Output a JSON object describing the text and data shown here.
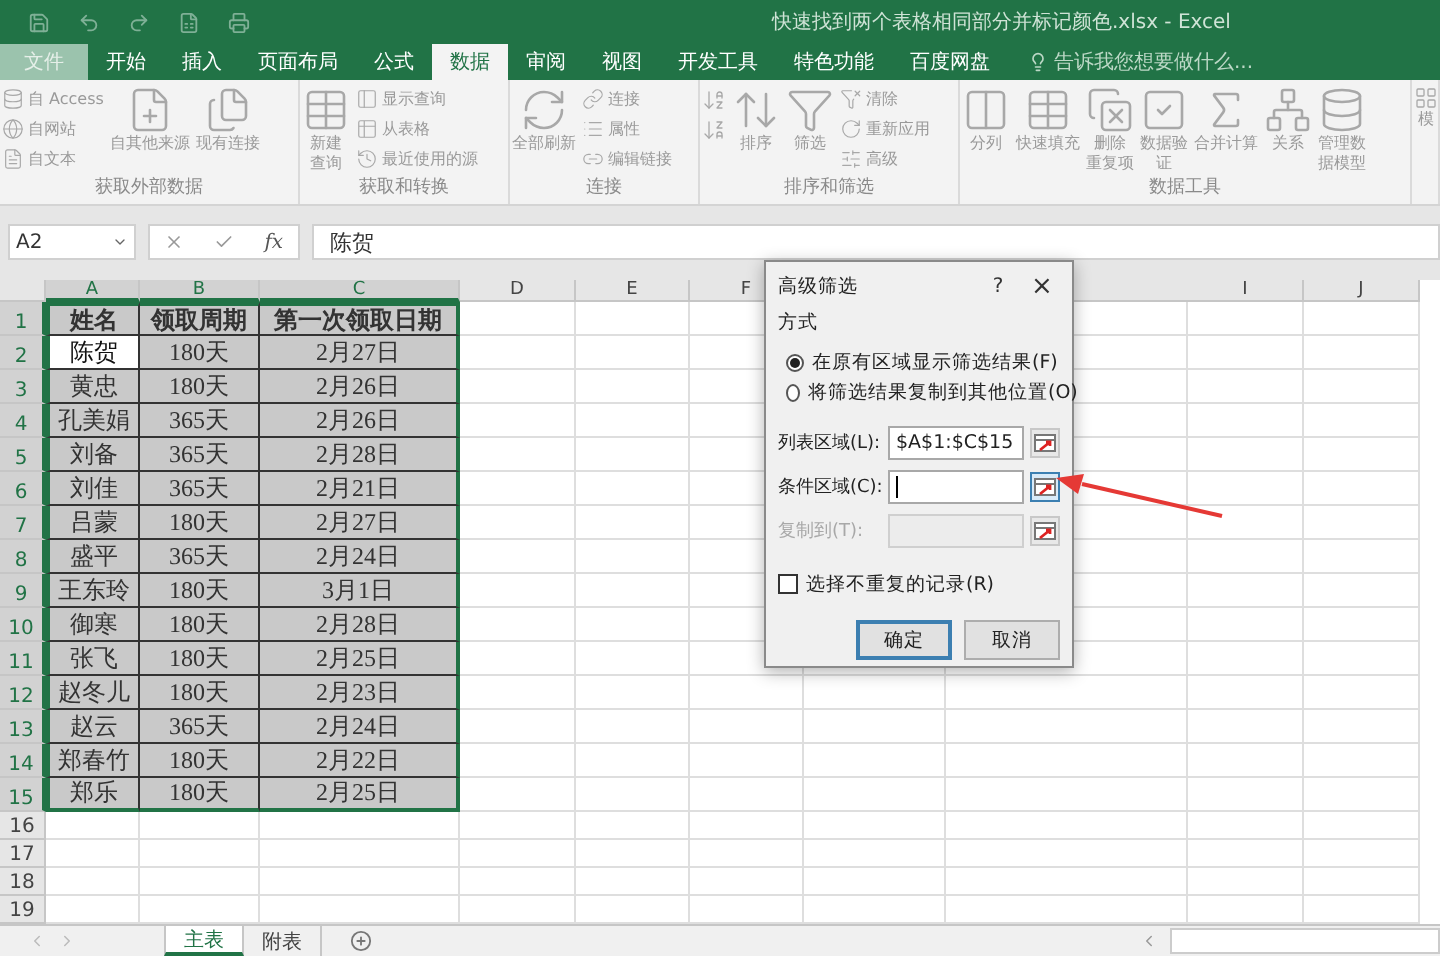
{
  "window": {
    "title": "快速找到两个表格相同部分并标记颜色.xlsx - Excel"
  },
  "tabs": [
    {
      "label": "文件",
      "kind": "file",
      "selected": false
    },
    {
      "label": "开始",
      "kind": "tab",
      "selected": false
    },
    {
      "label": "插入",
      "kind": "tab",
      "selected": false
    },
    {
      "label": "页面布局",
      "kind": "tab",
      "selected": false
    },
    {
      "label": "公式",
      "kind": "tab",
      "selected": false
    },
    {
      "label": "数据",
      "kind": "tab",
      "selected": true
    },
    {
      "label": "审阅",
      "kind": "tab",
      "selected": false
    },
    {
      "label": "视图",
      "kind": "tab",
      "selected": false
    },
    {
      "label": "开发工具",
      "kind": "tab",
      "selected": false
    },
    {
      "label": "特色功能",
      "kind": "tab",
      "selected": false
    },
    {
      "label": "百度网盘",
      "kind": "tab",
      "selected": false
    }
  ],
  "tell_me": {
    "placeholder": "告诉我您想要做什么..."
  },
  "ribbon": {
    "groups": [
      {
        "label": "获取外部数据",
        "items": [
          {
            "kind": "small",
            "lines": [
              "自 Access"
            ]
          },
          {
            "kind": "small",
            "lines": [
              "自网站"
            ]
          },
          {
            "kind": "small",
            "lines": [
              "自文本"
            ]
          },
          {
            "kind": "large",
            "lines": [
              "自其他来源"
            ]
          },
          {
            "kind": "large",
            "lines": [
              "现有连接"
            ]
          }
        ]
      },
      {
        "label": "获取和转换",
        "items": [
          {
            "kind": "large",
            "lines": [
              "新建",
              "查询"
            ]
          },
          {
            "kind": "small",
            "lines": [
              "显示查询"
            ]
          },
          {
            "kind": "small",
            "lines": [
              "从表格"
            ]
          },
          {
            "kind": "small",
            "lines": [
              "最近使用的源"
            ]
          }
        ]
      },
      {
        "label": "连接",
        "items": [
          {
            "kind": "large",
            "lines": [
              "全部刷新"
            ]
          },
          {
            "kind": "small",
            "lines": [
              "连接"
            ]
          },
          {
            "kind": "small",
            "lines": [
              "属性"
            ]
          },
          {
            "kind": "small",
            "lines": [
              "编辑链接"
            ]
          }
        ]
      },
      {
        "label": "排序和筛选",
        "items": [
          {
            "kind": "icon"
          },
          {
            "kind": "icon"
          },
          {
            "kind": "large",
            "lines": [
              "排序"
            ]
          },
          {
            "kind": "large",
            "lines": [
              "筛选"
            ]
          },
          {
            "kind": "small",
            "lines": [
              "清除"
            ]
          },
          {
            "kind": "small",
            "lines": [
              "重新应用"
            ]
          },
          {
            "kind": "small",
            "lines": [
              "高级"
            ]
          }
        ]
      },
      {
        "label": "数据工具",
        "items": [
          {
            "kind": "large",
            "lines": [
              "分列"
            ]
          },
          {
            "kind": "large",
            "lines": [
              "快速填充"
            ]
          },
          {
            "kind": "large",
            "lines": [
              "删除",
              "重复项"
            ]
          },
          {
            "kind": "large",
            "lines": [
              "数据验",
              "证"
            ]
          },
          {
            "kind": "large",
            "lines": [
              "合并计算"
            ]
          },
          {
            "kind": "large",
            "lines": [
              "关系"
            ]
          },
          {
            "kind": "large",
            "lines": [
              "管理数",
              "据模型"
            ]
          }
        ]
      },
      {
        "items": [
          {
            "kind": "large",
            "lines": [
              "模"
            ]
          }
        ]
      }
    ]
  },
  "formula_bar": {
    "name_box": "A2",
    "function_button": "fx",
    "value": "陈贺"
  },
  "sheet": {
    "columns_left": [
      {
        "label": "A",
        "selected": true
      },
      {
        "label": "B",
        "selected": true
      },
      {
        "label": "C",
        "selected": true
      },
      {
        "label": "D",
        "selected": false
      },
      {
        "label": "E",
        "selected": false
      },
      {
        "label": "F",
        "selected": false
      }
    ],
    "columns_right": [
      {
        "label": "I",
        "selected": false
      },
      {
        "label": "J",
        "selected": false
      }
    ],
    "rows": [
      {
        "header": "1",
        "kind": "header",
        "selected": true,
        "cells": [
          {
            "text": "姓名",
            "active": false
          },
          {
            "text": "领取周期",
            "active": false
          },
          {
            "text": "第一次领取日期",
            "active": false
          }
        ]
      },
      {
        "header": "2",
        "kind": "data",
        "selected": true,
        "cells": [
          {
            "text": "陈贺",
            "active": true
          },
          {
            "text": "180天",
            "active": false
          },
          {
            "text": "2月27日",
            "active": false
          }
        ]
      },
      {
        "header": "3",
        "kind": "data",
        "selected": true,
        "cells": [
          {
            "text": "黄忠",
            "active": false
          },
          {
            "text": "180天",
            "active": false
          },
          {
            "text": "2月26日",
            "active": false
          }
        ]
      },
      {
        "header": "4",
        "kind": "data",
        "selected": true,
        "cells": [
          {
            "text": "孔美娟",
            "active": false
          },
          {
            "text": "365天",
            "active": false
          },
          {
            "text": "2月26日",
            "active": false
          }
        ]
      },
      {
        "header": "5",
        "kind": "data",
        "selected": true,
        "cells": [
          {
            "text": "刘备",
            "active": false
          },
          {
            "text": "365天",
            "active": false
          },
          {
            "text": "2月28日",
            "active": false
          }
        ]
      },
      {
        "header": "6",
        "kind": "data",
        "selected": true,
        "cells": [
          {
            "text": "刘佳",
            "active": false
          },
          {
            "text": "365天",
            "active": false
          },
          {
            "text": "2月21日",
            "active": false
          }
        ]
      },
      {
        "header": "7",
        "kind": "data",
        "selected": true,
        "cells": [
          {
            "text": "吕蒙",
            "active": false
          },
          {
            "text": "180天",
            "active": false
          },
          {
            "text": "2月27日",
            "active": false
          }
        ]
      },
      {
        "header": "8",
        "kind": "data",
        "selected": true,
        "cells": [
          {
            "text": "盛平",
            "active": false
          },
          {
            "text": "365天",
            "active": false
          },
          {
            "text": "2月24日",
            "active": false
          }
        ]
      },
      {
        "header": "9",
        "kind": "data",
        "selected": true,
        "cells": [
          {
            "text": "王东玲",
            "active": false
          },
          {
            "text": "180天",
            "active": false
          },
          {
            "text": "3月1日",
            "active": false
          }
        ]
      },
      {
        "header": "10",
        "kind": "data",
        "selected": true,
        "cells": [
          {
            "text": "御寒",
            "active": false
          },
          {
            "text": "180天",
            "active": false
          },
          {
            "text": "2月28日",
            "active": false
          }
        ]
      },
      {
        "header": "11",
        "kind": "data",
        "selected": true,
        "cells": [
          {
            "text": "张飞",
            "active": false
          },
          {
            "text": "180天",
            "active": false
          },
          {
            "text": "2月25日",
            "active": false
          }
        ]
      },
      {
        "header": "12",
        "kind": "data",
        "selected": true,
        "cells": [
          {
            "text": "赵冬儿",
            "active": false
          },
          {
            "text": "180天",
            "active": false
          },
          {
            "text": "2月23日",
            "active": false
          }
        ]
      },
      {
        "header": "13",
        "kind": "data",
        "selected": true,
        "cells": [
          {
            "text": "赵云",
            "active": false
          },
          {
            "text": "365天",
            "active": false
          },
          {
            "text": "2月24日",
            "active": false
          }
        ]
      },
      {
        "header": "14",
        "kind": "data",
        "selected": true,
        "cells": [
          {
            "text": "郑春竹",
            "active": false
          },
          {
            "text": "180天",
            "active": false
          },
          {
            "text": "2月22日",
            "active": false
          }
        ]
      },
      {
        "header": "15",
        "kind": "data",
        "selected": true,
        "cells": [
          {
            "text": "郑乐",
            "active": false
          },
          {
            "text": "180天",
            "active": false
          },
          {
            "text": "2月25日",
            "active": false
          }
        ]
      },
      {
        "header": "16",
        "kind": "empty",
        "selected": false
      },
      {
        "header": "17",
        "kind": "empty",
        "selected": false
      },
      {
        "header": "18",
        "kind": "empty",
        "selected": false
      },
      {
        "header": "19",
        "kind": "empty",
        "selected": false
      }
    ]
  },
  "sheet_tabs": [
    {
      "label": "主表",
      "selected": true
    },
    {
      "label": "附表",
      "selected": false
    }
  ],
  "dialog": {
    "title": "高级筛选",
    "help": "?",
    "close": "×",
    "section": "方式",
    "radios": [
      {
        "label": "在原有区域显示筛选结果(F)",
        "selected": true
      },
      {
        "label": "将筛选结果复制到其他位置(O)",
        "selected": false
      }
    ],
    "fields": [
      {
        "label": "列表区域(L):",
        "value": "$A$1:$C$15",
        "focused": false,
        "disabled": false
      },
      {
        "label": "条件区域(C):",
        "focused": true,
        "disabled": false
      },
      {
        "label": "复制到(T):",
        "focused": false,
        "disabled": true
      }
    ],
    "checkbox": {
      "label": "选择不重复的记录(R)",
      "checked": false
    },
    "buttons": [
      {
        "label": "确定",
        "default": true
      },
      {
        "label": "取消",
        "default": false
      }
    ]
  }
}
